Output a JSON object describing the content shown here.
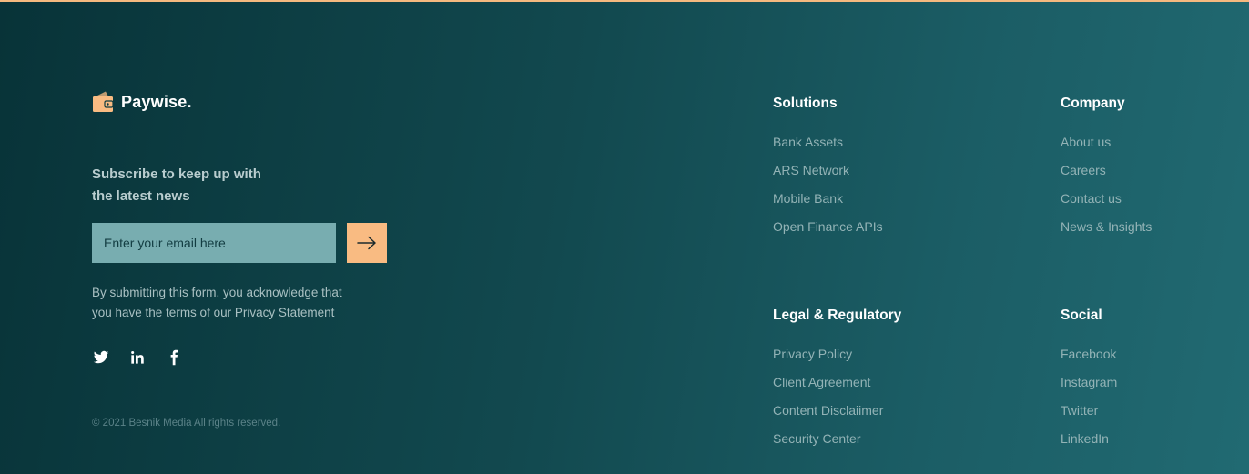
{
  "brand": {
    "name": "Paywise.",
    "icon": "wallet-icon",
    "accent": "#f9bb82"
  },
  "colors": {
    "background_start": "#083338",
    "background_end": "#216a72",
    "top_border": "#f5b97f",
    "input_bg": "#78adb0"
  },
  "subscribe": {
    "heading_line1": "Subscribe to keep up with",
    "heading_line2": "the latest news",
    "placeholder": "Enter your email here",
    "submit_icon": "arrow-right-icon",
    "disclaimer_line1": "By submitting this form, you acknowledge that",
    "disclaimer_line2": "you have the terms of our Privacy Statement"
  },
  "social_icons": [
    "twitter-icon",
    "linkedin-icon",
    "facebook-icon"
  ],
  "copyright": "© 2021 Besnik Media All rights reserved.",
  "columns": {
    "solutions": {
      "title": "Solutions",
      "links": [
        "Bank Assets",
        "ARS Network",
        "Mobile Bank",
        "Open Finance APIs"
      ]
    },
    "company": {
      "title": "Company",
      "links": [
        "About us",
        "Careers",
        "Contact us",
        "News & Insights"
      ]
    },
    "legal": {
      "title": "Legal & Regulatory",
      "links": [
        "Privacy Policy",
        "Client Agreement",
        "Content Disclaiimer",
        "Security Center"
      ]
    },
    "social": {
      "title": "Social",
      "links": [
        "Facebook",
        "Instagram",
        "Twitter",
        "LinkedIn"
      ]
    }
  }
}
